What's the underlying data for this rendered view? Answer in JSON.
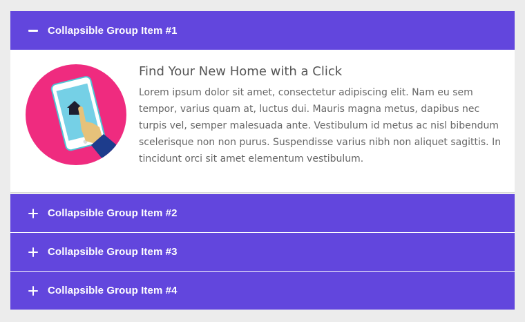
{
  "accordion": {
    "accent_color": "#6246dd",
    "items": [
      {
        "title": "Collapsible Group Item #1",
        "state": "expanded",
        "icon": "minus-icon",
        "body": {
          "image": "home-tablet-illustration",
          "heading": "Find Your New Home with a Click",
          "text": "Lorem ipsum dolor sit amet, consectetur adipiscing elit. Nam eu sem tempor, varius quam at, luctus dui. Mauris magna metus, dapibus nec turpis vel, semper malesuada ante. Vestibulum id metus ac nisl bibendum scelerisque non non purus. Suspendisse varius nibh non aliquet sagittis. In tincidunt orci sit amet elementum vestibulum."
        }
      },
      {
        "title": "Collapsible Group Item #2",
        "state": "collapsed",
        "icon": "plus-icon"
      },
      {
        "title": "Collapsible Group Item #3",
        "state": "collapsed",
        "icon": "plus-icon"
      },
      {
        "title": "Collapsible Group Item #4",
        "state": "collapsed",
        "icon": "plus-icon"
      }
    ]
  }
}
